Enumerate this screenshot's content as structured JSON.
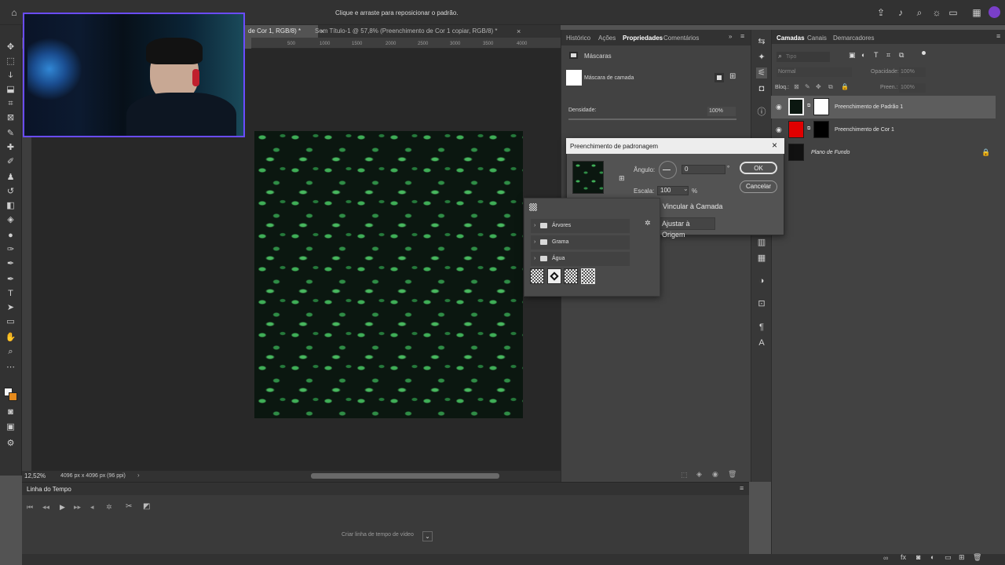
{
  "topbar": {
    "hint": "Clique e arraste para reposicionar o padrão.",
    "icons": [
      "home-icon",
      "share-icon",
      "bell-icon",
      "search-icon",
      "brightness-icon",
      "window-icon",
      "grid-icon",
      "avatar"
    ]
  },
  "tabs": [
    {
      "label": "de Cor 1, RGB/8) *",
      "active": true
    },
    {
      "label": "Sem Título-1 @ 57,8% (Preenchimento de Cor 1 copiar, RGB/8) *",
      "active": false
    }
  ],
  "ruler": {
    "ticks": [
      "500",
      "1000",
      "1500",
      "2000",
      "2500",
      "3000",
      "3500",
      "4000"
    ]
  },
  "status": {
    "zoom": "12,52%",
    "doc_info": "4096 px x 4096 px (96 ppi)"
  },
  "timeline": {
    "title": "Linha do Tempo",
    "create_button": "Criar linha de tempo de vídeo"
  },
  "properties": {
    "tabs": [
      "Histórico",
      "Ações",
      "Propriedades",
      "Comentários"
    ],
    "section": "Máscaras",
    "mask_label": "Máscara de camada",
    "density_label": "Densidade:",
    "density_value": "100%"
  },
  "layers_panel": {
    "tabs": [
      "Camadas",
      "Canais",
      "Demarcadores"
    ],
    "search_placeholder": "Tipo",
    "blend_mode": "Normal",
    "opacity_label": "Opacidade:",
    "opacity_value": "100%",
    "lock_label": "Bloq.:",
    "fill_label": "Preen.:",
    "fill_value": "100%",
    "layers": [
      {
        "name": "Preenchimento de Padrão 1",
        "selected": true
      },
      {
        "name": "Preenchimento de Cor 1",
        "selected": false
      },
      {
        "name": "Plano de Fundo",
        "selected": false
      }
    ]
  },
  "dialog": {
    "title": "Preenchimento de padronagem",
    "angle_label": "Ângulo:",
    "angle_value": "0",
    "angle_unit": "°",
    "scale_label": "Escala:",
    "scale_value": "100",
    "scale_unit": "%",
    "link_label": "Vincular à Camada",
    "snap_button": "Ajustar à Origem",
    "ok_button": "OK",
    "cancel_button": "Cancelar"
  },
  "picker": {
    "folders": [
      "Árvores",
      "Grama",
      "Água"
    ],
    "swatch_count": 4
  },
  "colors": {
    "accent_webcam_border": "#6a4cff",
    "layer_color_fill": "#e00000",
    "selected_layer": "#5d5d5d"
  }
}
